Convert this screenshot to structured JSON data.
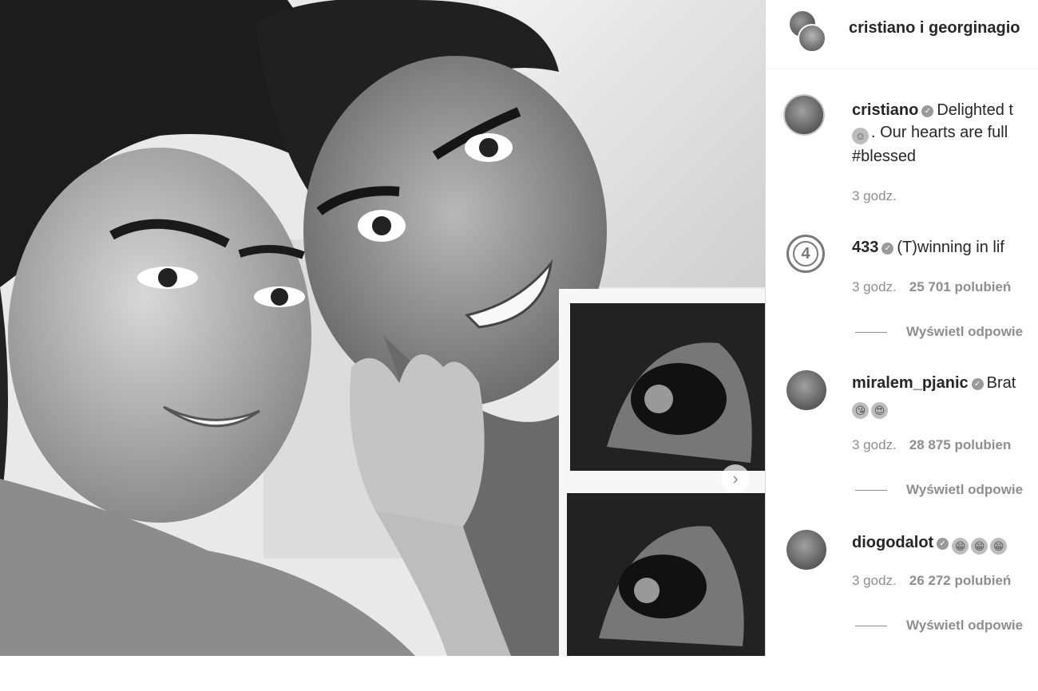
{
  "post": {
    "header": {
      "accounts": "cristiano i georginagio"
    },
    "caption": {
      "username": "cristiano",
      "text_line1": "Delighted t",
      "text_line2": ". Our hearts are full",
      "text_line3": "#blessed",
      "time": "3 godz."
    },
    "comments": [
      {
        "username": "433",
        "text": "(T)winning in lif",
        "time": "3 godz.",
        "likes": "25 701 polubień",
        "replies": "Wyświetl odpowie"
      },
      {
        "username": "miralem_pjanic",
        "text": "Brat",
        "time": "3 godz.",
        "likes": "28 875 polubien",
        "replies": "Wyświetl odpowie"
      },
      {
        "username": "diogodalot",
        "text": "",
        "time": "3 godz.",
        "likes": "26 272 polubień",
        "replies": "Wyświetl odpowie"
      }
    ]
  },
  "icons": {
    "verified": "verified-badge-icon",
    "next": "chevron-right-icon",
    "baby": "baby-emoji",
    "kiss": "kissing-emoji",
    "hearts": "heart-eyes-emoji",
    "grin": "grinning-emoji"
  },
  "colors": {
    "text": "#262626",
    "muted": "#8e8e8e",
    "border": "#dbdbdb"
  }
}
